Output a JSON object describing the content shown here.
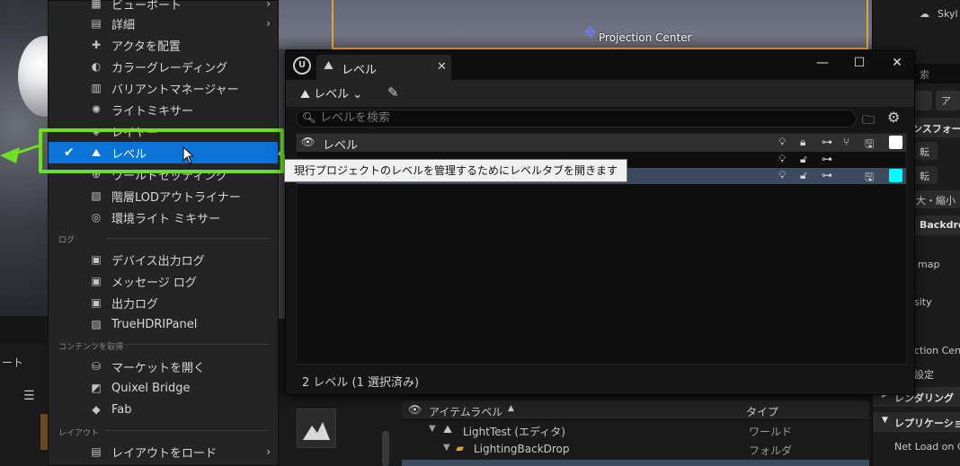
{
  "viewport": {
    "projection_label": "Projection Center"
  },
  "menu": {
    "items_top": [
      {
        "icon": "viewport-icon",
        "label": "ビューポート",
        "submenu": true
      },
      {
        "icon": "details-icon",
        "label": "詳細",
        "submenu": true
      },
      {
        "icon": "place-actors-icon",
        "label": "アクタを配置",
        "submenu": false
      },
      {
        "icon": "color-grading-icon",
        "label": "カラーグレーディング",
        "submenu": false
      },
      {
        "icon": "variant-manager-icon",
        "label": "バリアントマネージャー",
        "submenu": false
      },
      {
        "icon": "light-mixer-icon",
        "label": "ライトミキサー",
        "submenu": false
      },
      {
        "icon": "layers-icon",
        "label": "レイヤー",
        "submenu": false
      },
      {
        "icon": "levels-icon",
        "label": "レベル",
        "submenu": false,
        "checked": true
      },
      {
        "icon": "world-settings-icon",
        "label": "ワールドセッティング",
        "submenu": false
      },
      {
        "icon": "hlod-outliner-icon",
        "label": "階層LODアウトライナー",
        "submenu": false
      },
      {
        "icon": "env-light-mixer-icon",
        "label": "環境ライト ミキサー",
        "submenu": false
      }
    ],
    "section_log": "ログ",
    "items_log": [
      {
        "icon": "device-log-icon",
        "label": "デバイス出力ログ"
      },
      {
        "icon": "message-log-icon",
        "label": "メッセージ ログ"
      },
      {
        "icon": "output-log-icon",
        "label": "出力ログ"
      },
      {
        "icon": "hdri-panel-icon",
        "label": "TrueHDRIPanel"
      }
    ],
    "section_content": "コンテンツを取得",
    "items_content": [
      {
        "icon": "marketplace-icon",
        "label": "マーケットを開く"
      },
      {
        "icon": "quixel-icon",
        "label": "Quixel Bridge"
      },
      {
        "icon": "fab-icon",
        "label": "Fab"
      }
    ],
    "section_layout": "レイアウト",
    "items_layout": [
      {
        "icon": "load-layout-icon",
        "label": "レイアウトをロード",
        "submenu": true
      }
    ]
  },
  "tooltip": {
    "text": "現行プロジェクトのレベルを管理するためにレベルタブを開きます"
  },
  "levels_window": {
    "tab_label": "レベル",
    "toolbar_level_label": "レベル",
    "search_placeholder": "レベルを検索",
    "column_label": "レベル",
    "status": "2 レベル (1 選択済み)",
    "row_colors": [
      "#ffffff",
      "#00ffff"
    ]
  },
  "details": {
    "top_label": "Skyl",
    "search_fragment": "索",
    "transform_fragment": "ンスフォーム",
    "fragment_1": "転",
    "fragment_2": "大・縮小",
    "backdrop_label": "Backdrop",
    "map_fragment": "map",
    "sity_fragment": "sity",
    "ction_fragment": "ction Cen",
    "setting_fragment": "設定",
    "rendering_label": "レンダリング",
    "replication_label": "レプリケーション",
    "net_load_label": "Net Load on Cl",
    "add_fragment": "ア"
  },
  "outliner": {
    "col_label": "アイテムラベル",
    "col_type": "タイプ",
    "rows": [
      {
        "label": "LightTest (エディタ)",
        "type": "ワールド"
      },
      {
        "label": "LightingBackDrop",
        "type": "フォルダ"
      }
    ]
  },
  "bottom_left": {
    "fragment": "ート"
  }
}
